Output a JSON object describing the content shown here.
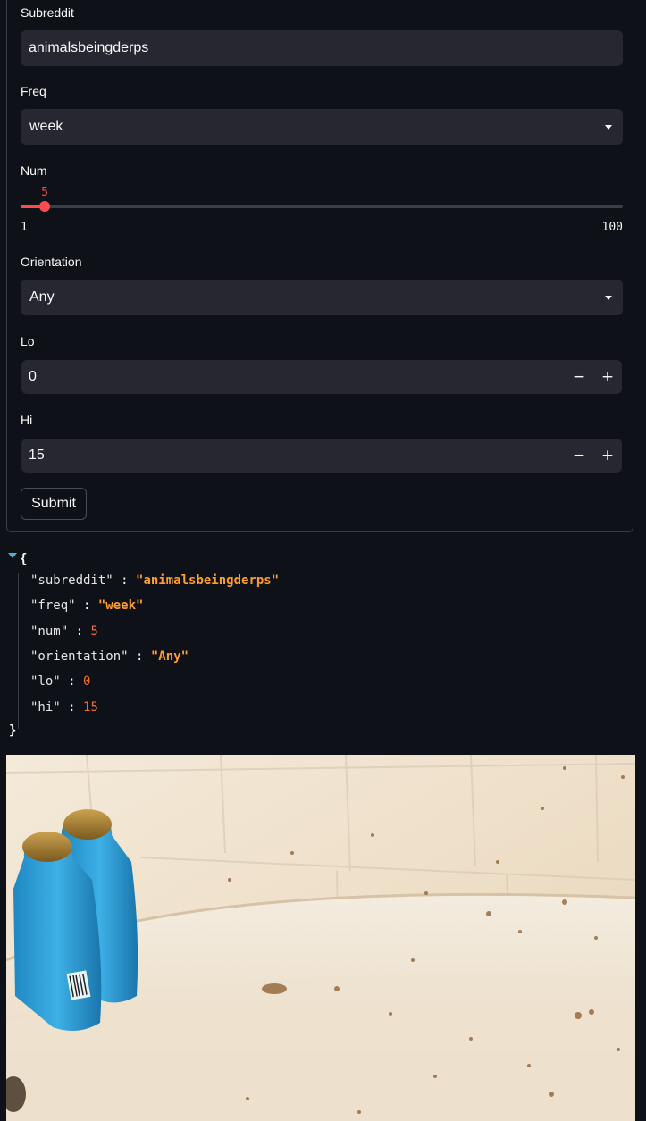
{
  "form": {
    "subreddit": {
      "label": "Subreddit",
      "value": "animalsbeingderps"
    },
    "freq": {
      "label": "Freq",
      "value": "week"
    },
    "num": {
      "label": "Num",
      "value": 5,
      "min": 1,
      "max": 100,
      "value_text": "5",
      "min_text": "1",
      "max_text": "100"
    },
    "orientation": {
      "label": "Orientation",
      "value": "Any"
    },
    "lo": {
      "label": "Lo",
      "value": "0",
      "minus": "−",
      "plus": "+"
    },
    "hi": {
      "label": "Hi",
      "value": "15",
      "minus": "−",
      "plus": "+"
    },
    "submit_label": "Submit"
  },
  "json_output": {
    "open": "{",
    "close": "}",
    "entries": [
      {
        "key": "\"subreddit\"",
        "value": "\"animalsbeingderps\""
      },
      {
        "key": "\"freq\"",
        "value": "\"week\""
      },
      {
        "key": "\"num\"",
        "value": "5"
      },
      {
        "key": "\"orientation\"",
        "value": "\"Any\""
      },
      {
        "key": "\"lo\"",
        "value": "0"
      },
      {
        "key": "\"hi\"",
        "value": "15"
      }
    ]
  },
  "colors": {
    "background": "#0e1117",
    "input_bg": "#262730",
    "accent": "#ff4b4b",
    "json_string": "#ff9d2e",
    "json_number": "#f06c39",
    "toggle": "#4fb3d9"
  },
  "icons": {
    "select_chevron": "chevron-down-icon",
    "json_toggle": "caret-down-icon"
  }
}
